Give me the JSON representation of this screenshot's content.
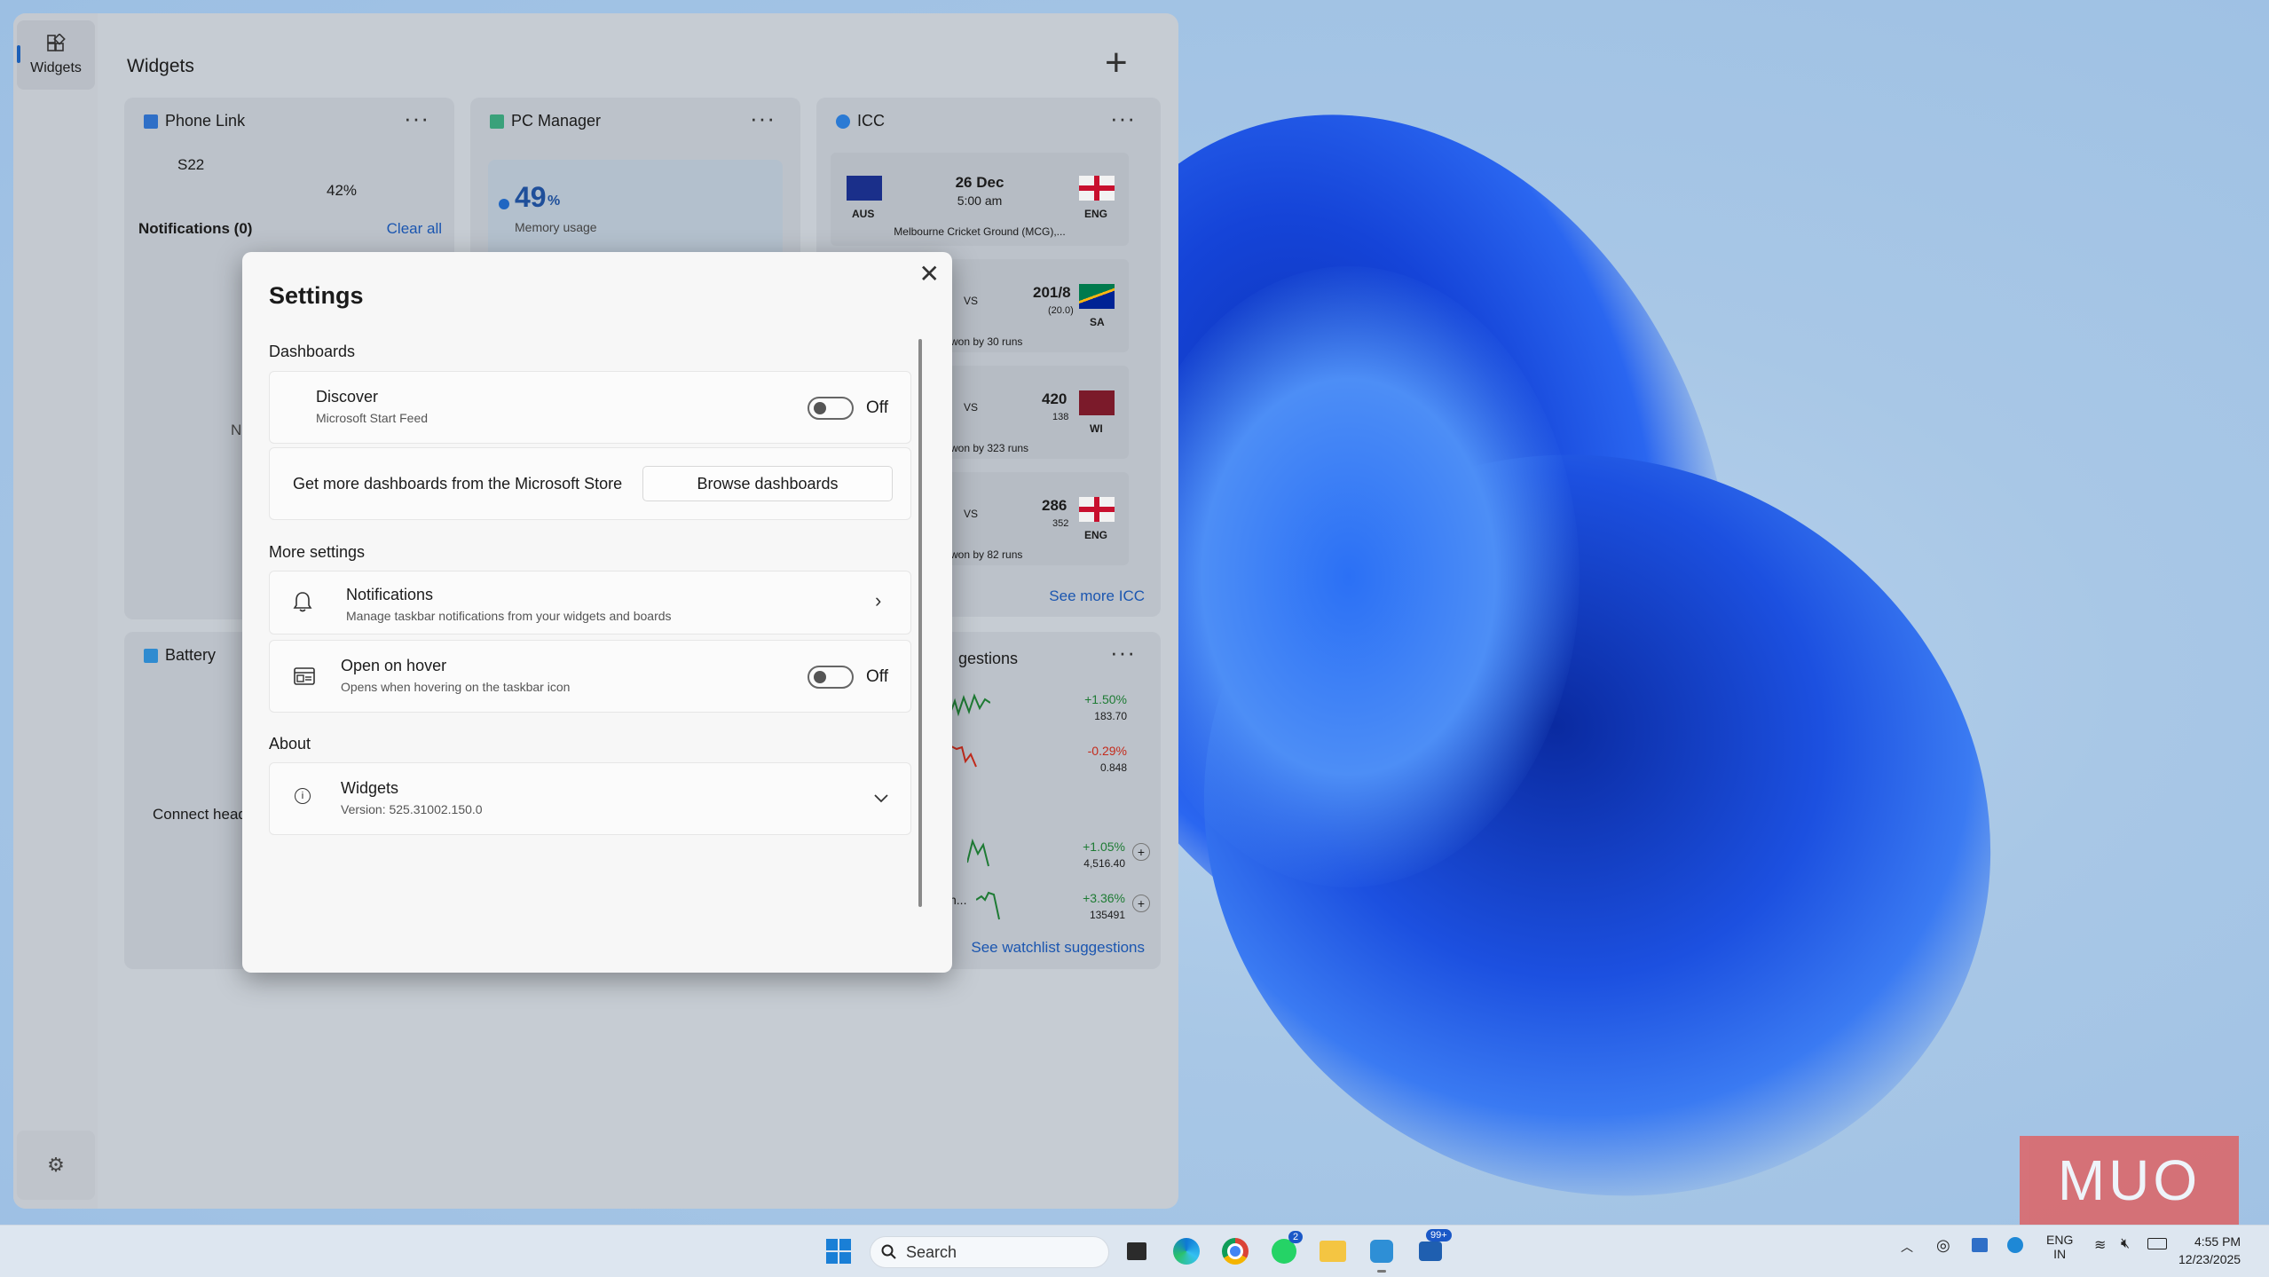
{
  "colors": {
    "accent": "#1b56b0",
    "overlay": "#c6ccd3",
    "positive": "#1e7b34",
    "negative": "#c42b1c"
  },
  "board": {
    "rail_label": "Widgets",
    "title": "Widgets",
    "add_icon": "plus-icon",
    "settings_icon": "gear-icon"
  },
  "phone_link": {
    "title": "Phone Link",
    "device": "S22",
    "battery": "42%",
    "notifications": "Notifications (0)",
    "clear_all": "Clear all",
    "partial_text": "No"
  },
  "pc_manager": {
    "title": "PC Manager",
    "value": "49",
    "unit": "%",
    "label": "Memory usage"
  },
  "icc": {
    "title": "ICC",
    "upcoming": {
      "date": "26 Dec",
      "time": "5:00 am",
      "team1": "AUS",
      "team2": "ENG",
      "venue": "Melbourne Cricket Ground (MCG),..."
    },
    "results": [
      {
        "vs": "VS",
        "score": "201/8",
        "overs": "(20.0)",
        "team": "SA",
        "result": "won by 30 runs"
      },
      {
        "vs": "VS",
        "score": "420",
        "overs": "138",
        "team": "WI",
        "result": "won by 323 runs"
      },
      {
        "vs": "VS",
        "score": "286",
        "overs": "352",
        "team": "ENG",
        "result": "won by 82 runs"
      }
    ],
    "see_more": "See more ICC"
  },
  "battery": {
    "title": "Battery",
    "partial_text": "Connect head"
  },
  "watchlist": {
    "title_partial": "gestions",
    "items": [
      {
        "change": "+1.50%",
        "price": "183.70"
      },
      {
        "change": "-0.29%",
        "price": "0.848"
      },
      {
        "change": "+1.05%",
        "price": "4,516.40"
      },
      {
        "name_partial": "n...",
        "change": "+3.36%",
        "price": "135491"
      }
    ],
    "see_more": "See watchlist suggestions"
  },
  "settings": {
    "title": "Settings",
    "close_icon": "close-icon",
    "dashboards_header": "Dashboards",
    "discover": {
      "title": "Discover",
      "subtitle": "Microsoft Start Feed",
      "state": "Off"
    },
    "store": {
      "text": "Get more dashboards from the Microsoft Store",
      "button": "Browse dashboards"
    },
    "more_header": "More settings",
    "notifications": {
      "title": "Notifications",
      "subtitle": "Manage taskbar notifications from your widgets and boards"
    },
    "hover": {
      "title": "Open on hover",
      "subtitle": "Opens when hovering on the taskbar icon",
      "state": "Off"
    },
    "about_header": "About",
    "about": {
      "title": "Widgets",
      "subtitle": "Version: 525.31002.150.0"
    }
  },
  "taskbar": {
    "search_placeholder": "Search",
    "whatsapp_badge": "2",
    "widgets_badge": "99+",
    "lang1": "ENG",
    "lang2": "IN",
    "time": "4:55 PM",
    "date": "12/23/2025"
  },
  "watermark": "MUO"
}
